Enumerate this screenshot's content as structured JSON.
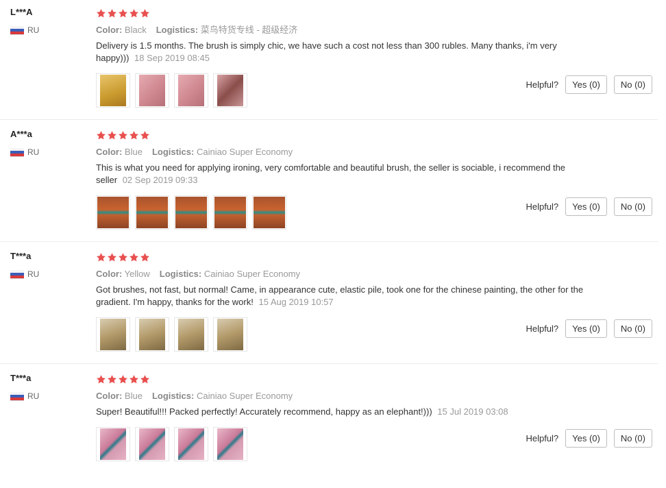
{
  "colors": {
    "star": "#e8504f",
    "accent_label": "#888888",
    "date": "#999999"
  },
  "helpful_label": "Helpful?",
  "reviews": [
    {
      "user": "L***A",
      "country": "RU",
      "rating": 5,
      "color_label": "Color:",
      "color_value": "Black",
      "logistics_label": "Logistics:",
      "logistics_value": "菜鸟特货专线 - 超级经济",
      "text": "Delivery is 1.5 months. The brush is simply chic, we have such a cost not less than 300 rubles. Many thanks, i'm very happy)))",
      "date": "18 Sep 2019 08:45",
      "yes": "Yes (0)",
      "no": "No (0)",
      "photos": [
        "yellow-package-photo",
        "pink-brush-photo",
        "pink-brush-photo",
        "brush-in-hand-photo"
      ]
    },
    {
      "user": "A***a",
      "country": "RU",
      "rating": 5,
      "color_label": "Color:",
      "color_value": "Blue",
      "logistics_label": "Logistics:",
      "logistics_value": "Cainiao Super Economy",
      "text": "This is what you need for applying ironing, very comfortable and beautiful brush, the seller is sociable, i recommend the seller",
      "date": "02 Sep 2019 09:33",
      "yes": "Yes (0)",
      "no": "No (0)",
      "photos": [
        "blue-brush-photo",
        "blue-brush-photo",
        "blue-brush-photo",
        "blue-brush-photo",
        "blue-brush-photo"
      ]
    },
    {
      "user": "T***a",
      "country": "RU",
      "rating": 5,
      "color_label": "Color:",
      "color_value": "Yellow",
      "logistics_label": "Logistics:",
      "logistics_value": "Cainiao Super Economy",
      "text": "Got brushes, not fast, but normal! Came, in appearance cute, elastic pile, took one for the chinese painting, the other for the gradient. I'm happy, thanks for the work!",
      "date": "15 Aug 2019 10:57",
      "yes": "Yes (0)",
      "no": "No (0)",
      "photos": [
        "gold-brush-photo",
        "gold-brush-photo",
        "gold-brush-photo",
        "gold-brush-photo"
      ]
    },
    {
      "user": "T***a",
      "country": "RU",
      "rating": 5,
      "color_label": "Color:",
      "color_value": "Blue",
      "logistics_label": "Logistics:",
      "logistics_value": "Cainiao Super Economy",
      "text": "Super! Beautiful!!! Packed perfectly! Accurately recommend, happy as an elephant!)))",
      "date": "15 Jul 2019 03:08",
      "yes": "Yes (0)",
      "no": "No (0)",
      "photos": [
        "pink-fabric-brush-photo",
        "pink-fabric-brush-photo",
        "pink-fabric-brush-photo",
        "pink-fabric-brush-photo"
      ]
    }
  ]
}
